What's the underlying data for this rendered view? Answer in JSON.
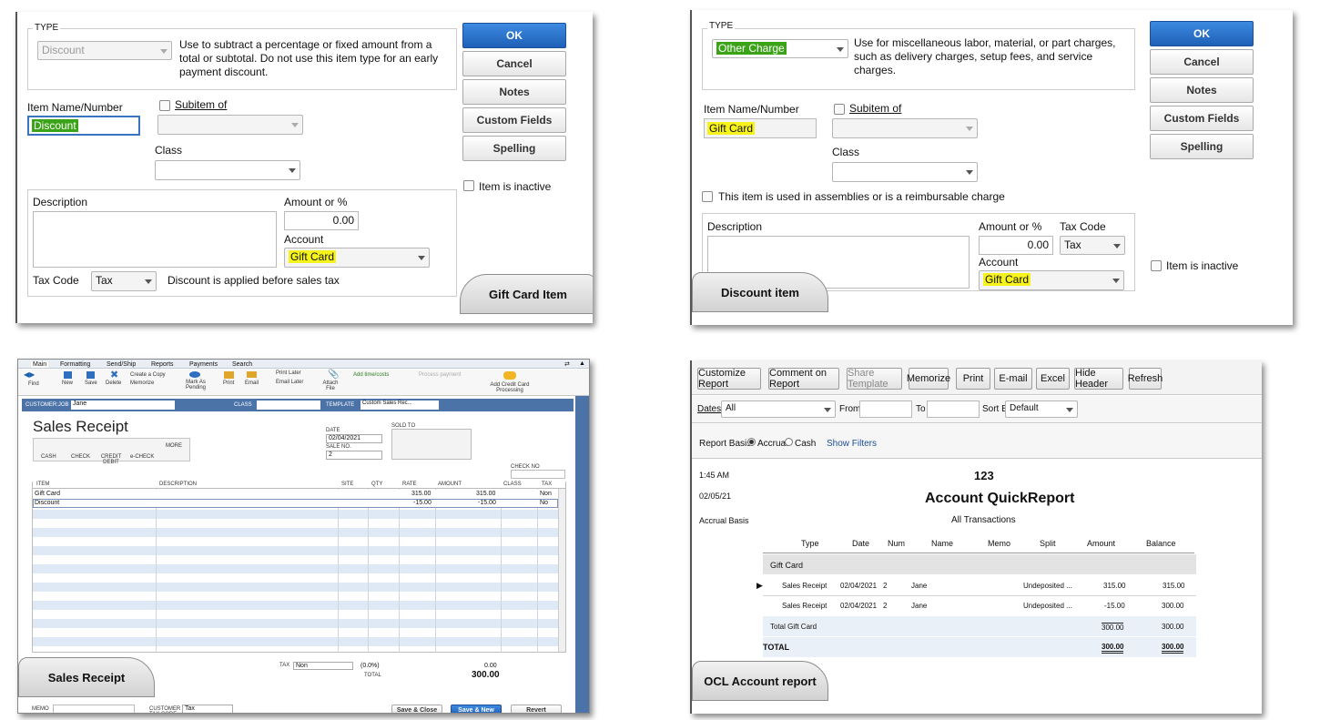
{
  "gift_card_item": {
    "type_label": "TYPE",
    "type_value": "Discount",
    "type_desc": "Use to subtract a percentage or fixed amount from a total or subtotal. Do not use this item type for an early payment discount.",
    "item_name_label": "Item Name/Number",
    "item_name_value": "Discount",
    "subitem_label": "Subitem of",
    "class_label": "Class",
    "description_label": "Description",
    "amount_label": "Amount or %",
    "amount_value": "0.00",
    "account_label": "Account",
    "account_value": "Gift Card",
    "tax_code_label": "Tax Code",
    "tax_code_value": "Tax",
    "tax_note": "Discount is applied before sales tax",
    "buttons": {
      "ok": "OK",
      "cancel": "Cancel",
      "notes": "Notes",
      "custom_fields": "Custom Fields",
      "spelling": "Spelling"
    },
    "inactive_label": "Item is inactive",
    "tab_label": "Gift Card Item"
  },
  "discount_item": {
    "type_label": "TYPE",
    "type_value": "Other Charge",
    "type_desc": "Use for miscellaneous labor, material, or part charges, such as delivery charges, setup fees, and service charges.",
    "item_name_label": "Item Name/Number",
    "item_name_value": "Gift Card",
    "subitem_label": "Subitem of",
    "class_label": "Class",
    "assemblies_label": "This item is used in assemblies or is a reimbursable charge",
    "description_label": "Description",
    "amount_label": "Amount or %",
    "amount_value": "0.00",
    "tax_code_label": "Tax Code",
    "tax_code_value": "Tax",
    "account_label": "Account",
    "account_value": "Gift Card",
    "buttons": {
      "ok": "OK",
      "cancel": "Cancel",
      "notes": "Notes",
      "custom_fields": "Custom Fields",
      "spelling": "Spelling"
    },
    "inactive_label": "Item is inactive",
    "tab_label": "Discount item"
  },
  "sales_receipt": {
    "menu_tabs": [
      "Main",
      "Formatting",
      "Send/Ship",
      "Reports",
      "Payments",
      "Search"
    ],
    "toolbar": {
      "find": "Find",
      "new": "New",
      "save": "Save",
      "delete": "Delete",
      "create_copy": "Create a Copy",
      "memorize": "Memorize",
      "mark_pending": "Mark As Pending",
      "print": "Print",
      "email": "Email",
      "print_later": "Print Later",
      "email_later": "Email Later",
      "attach_file": "Attach File",
      "add_time_costs": "Add time/costs",
      "process_payment": "Process payment",
      "add_cc": "Add Credit Card Processing"
    },
    "customer_job_label": "CUSTOMER:JOB",
    "customer_job_value": "Jane",
    "class_label": "CLASS",
    "template_label": "TEMPLATE",
    "template_value": "Custom Sales Rec...",
    "title": "Sales Receipt",
    "date_label": "DATE",
    "date_value": "02/04/2021",
    "sale_no_label": "SALE NO.",
    "sale_no_value": "2",
    "sold_to_label": "SOLD TO",
    "check_no_label": "CHECK NO",
    "pay_methods": [
      "CASH",
      "CHECK",
      "CREDIT DEBIT",
      "e-CHECK",
      "MORE"
    ],
    "columns": [
      "ITEM",
      "DESCRIPTION",
      "SITE",
      "QTY",
      "RATE",
      "AMOUNT",
      "CLASS",
      "TAX"
    ],
    "rows": [
      {
        "item": "Gift Card",
        "rate": "315.00",
        "amount": "315.00",
        "tax": "Non"
      },
      {
        "item": "Discount",
        "rate": "-15.00",
        "amount": "-15.00",
        "tax": "No"
      }
    ],
    "tax_label": "TAX",
    "tax_value": "Non",
    "tax_pct": "(0.0%)",
    "tax_amount": "0.00",
    "total_label": "TOTAL",
    "total_value": "300.00",
    "memo_label": "MEMO",
    "customer_tax_code_label": "CUSTOMER TAX CODE",
    "customer_tax_code_value": "Tax",
    "buttons": {
      "save_close": "Save & Close",
      "save_new": "Save & New",
      "revert": "Revert"
    },
    "tab_label": "Sales Receipt"
  },
  "report": {
    "toolbar": [
      "Customize Report",
      "Comment on Report",
      "Share Template",
      "Memorize",
      "Print",
      "E-mail",
      "Excel",
      "Hide Header",
      "Refresh"
    ],
    "dates_label": "Dates",
    "dates_value": "All",
    "from_label": "From",
    "to_label": "To",
    "sort_by_label": "Sort By",
    "sort_by_value": "Default",
    "report_basis_label": "Report Basis:",
    "accrual_label": "Accrual",
    "cash_label": "Cash",
    "show_filters": "Show Filters",
    "time": "1:45 AM",
    "date": "02/05/21",
    "basis": "Accrual Basis",
    "company": "123",
    "title": "Account QuickReport",
    "subtitle": "All Transactions",
    "columns": [
      "Type",
      "Date",
      "Num",
      "Name",
      "Memo",
      "Split",
      "Amount",
      "Balance"
    ],
    "group_label": "Gift Card",
    "rows": [
      {
        "type": "Sales Receipt",
        "date": "02/04/2021",
        "num": "2",
        "name": "Jane",
        "split": "Undeposited ...",
        "amount": "315.00",
        "balance": "315.00"
      },
      {
        "type": "Sales Receipt",
        "date": "02/04/2021",
        "num": "2",
        "name": "Jane",
        "split": "Undeposited ...",
        "amount": "-15.00",
        "balance": "300.00"
      }
    ],
    "group_total_label": "Total Gift Card",
    "group_total_amount": "300.00",
    "group_total_balance": "300.00",
    "total_label": "TOTAL",
    "total_amount": "300.00",
    "total_balance": "300.00",
    "tab_label": "OCL Account report"
  }
}
